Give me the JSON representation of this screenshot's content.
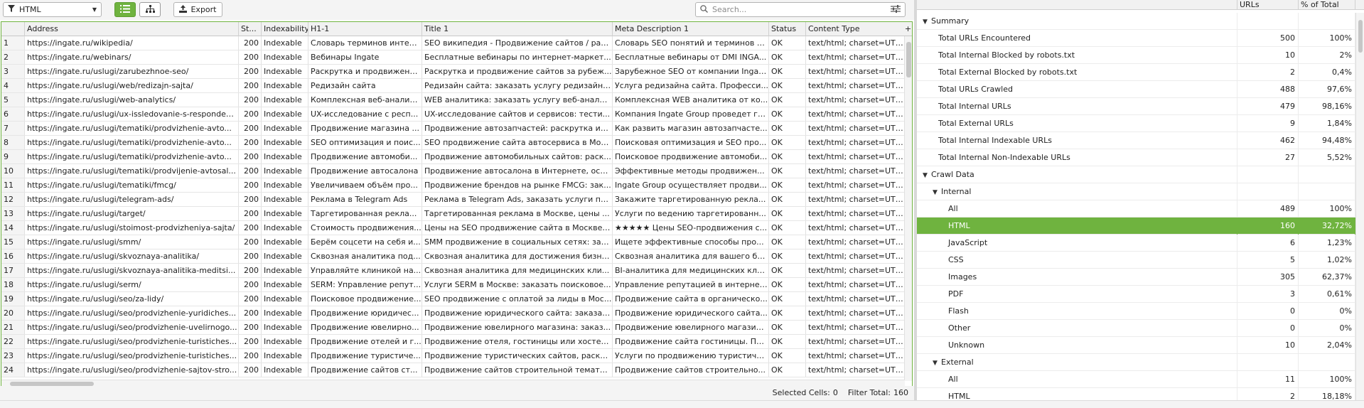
{
  "toolbar": {
    "filter_label": "HTML",
    "export_label": "Export",
    "search_placeholder": "Search..."
  },
  "table": {
    "columns": [
      "",
      "Address",
      "St...",
      "Indexability",
      "H1-1",
      "Title 1",
      "Meta Description 1",
      "Status",
      "Content Type"
    ],
    "rows": [
      {
        "num": "1",
        "address": "https://ingate.ru/wikipedia/",
        "code": "200",
        "indexability": "Indexable",
        "h1": "Словарь терминов интер...",
        "title": "SEO википедия - Продвижение сайтов / рас...",
        "meta": "Словарь SEO понятий и терминов в...",
        "status": "OK",
        "content_type": "text/html; charset=UTF-8"
      },
      {
        "num": "2",
        "address": "https://ingate.ru/webinars/",
        "code": "200",
        "indexability": "Indexable",
        "h1": "Вебинары Ingate",
        "title": "Бесплатные вебинары по интернет-маркет...",
        "meta": "Бесплатные вебинары от DMI INGA...",
        "status": "OK",
        "content_type": "text/html; charset=UTF-8"
      },
      {
        "num": "3",
        "address": "https://ingate.ru/uslugi/zarubezhnoe-seo/",
        "code": "200",
        "indexability": "Indexable",
        "h1": "Раскрутка и продвижени...",
        "title": "Раскрутка и продвижение сайтов за рубеж...",
        "meta": "Зарубежное SEO от компании Ingat...",
        "status": "OK",
        "content_type": "text/html; charset=UTF-8"
      },
      {
        "num": "4",
        "address": "https://ingate.ru/uslugi/web/redizajn-sajta/",
        "code": "200",
        "indexability": "Indexable",
        "h1": "Редизайн сайта",
        "title": "Редизайн сайта: заказать услугу редизайна...",
        "meta": "Услуга редизайна сайта. Професси...",
        "status": "OK",
        "content_type": "text/html; charset=UTF-8"
      },
      {
        "num": "5",
        "address": "https://ingate.ru/uslugi/web-analytics/",
        "code": "200",
        "indexability": "Indexable",
        "h1": "Комплексная веб-аналит...",
        "title": "WEB аналитика: заказать услугу веб-аналит...",
        "meta": "Комплексная WEB аналитика от ко...",
        "status": "OK",
        "content_type": "text/html; charset=UTF-8"
      },
      {
        "num": "6",
        "address": "https://ingate.ru/uslugi/ux-issledovanie-s-responden...",
        "code": "200",
        "indexability": "Indexable",
        "h1": "UX-исследование с респ...",
        "title": "UX-исследование сайтов и сервисов: тести...",
        "meta": "Компания Ingate Group проведет гл...",
        "status": "OK",
        "content_type": "text/html; charset=UTF-8"
      },
      {
        "num": "7",
        "address": "https://ingate.ru/uslugi/tematiki/prodvizhenie-avto...",
        "code": "200",
        "indexability": "Indexable",
        "h1": "Продвижение магазина ...",
        "title": "Продвижение автозапчастей: раскрутка ин...",
        "meta": "Как развить магазин автозапчасте...",
        "status": "OK",
        "content_type": "text/html; charset=UTF-8"
      },
      {
        "num": "8",
        "address": "https://ingate.ru/uslugi/tematiki/prodvizhenie-avto...",
        "code": "200",
        "indexability": "Indexable",
        "h1": "SEO оптимизация и поис...",
        "title": "SEO продвижение сайта автосервиса в Мос...",
        "meta": "Поисковая оптимизация и SEO про...",
        "status": "OK",
        "content_type": "text/html; charset=UTF-8"
      },
      {
        "num": "9",
        "address": "https://ingate.ru/uslugi/tematiki/prodvizhenie-avto...",
        "code": "200",
        "indexability": "Indexable",
        "h1": "Продвижение автомоби...",
        "title": "Продвижение автомобильных сайтов: раск...",
        "meta": "Поисковое продвижение автомоби...",
        "status": "OK",
        "content_type": "text/html; charset=UTF-8"
      },
      {
        "num": "10",
        "address": "https://ingate.ru/uslugi/tematiki/prodvijenie-avtosal...",
        "code": "200",
        "indexability": "Indexable",
        "h1": "Продвижение автосалона",
        "title": "Продвижение автосалона в Интернете, осо...",
        "meta": "Эффективные методы продвижен...",
        "status": "OK",
        "content_type": "text/html; charset=UTF-8"
      },
      {
        "num": "11",
        "address": "https://ingate.ru/uslugi/tematiki/fmcg/",
        "code": "200",
        "indexability": "Indexable",
        "h1": "Увеличиваем объём про...",
        "title": "Продвижение брендов на рынке FMCG: зак...",
        "meta": "Ingate Group осуществляет продви...",
        "status": "OK",
        "content_type": "text/html; charset=UTF-8"
      },
      {
        "num": "12",
        "address": "https://ingate.ru/uslugi/telegram-ads/",
        "code": "200",
        "indexability": "Indexable",
        "h1": "Реклама в Telegram Ads",
        "title": "Реклама в Telegram Ads, заказать услуги пр...",
        "meta": "Закажите таргетированную рекла...",
        "status": "OK",
        "content_type": "text/html; charset=UTF-8"
      },
      {
        "num": "13",
        "address": "https://ingate.ru/uslugi/target/",
        "code": "200",
        "indexability": "Indexable",
        "h1": "Таргетированная рекла...",
        "title": "Таргетированная реклама в Москве, цены ...",
        "meta": "Услуги по ведению таргетированн...",
        "status": "OK",
        "content_type": "text/html; charset=UTF-8"
      },
      {
        "num": "14",
        "address": "https://ingate.ru/uslugi/stoimost-prodvizheniya-sajta/",
        "code": "200",
        "indexability": "Indexable",
        "h1": "Стоимость продвижения...",
        "title": "Цены на SEO продвижение сайта в Москве ...",
        "meta": "★★★★★ Цены SEO-продвижения с...",
        "status": "OK",
        "content_type": "text/html; charset=UTF-8"
      },
      {
        "num": "15",
        "address": "https://ingate.ru/uslugi/smm/",
        "code": "200",
        "indexability": "Indexable",
        "h1": "Берём соцсети на себя и...",
        "title": "SMM продвижение в социальных сетях: зак...",
        "meta": "Ищете эффективные способы про...",
        "status": "OK",
        "content_type": "text/html; charset=UTF-8"
      },
      {
        "num": "16",
        "address": "https://ingate.ru/uslugi/skvoznaya-analitika/",
        "code": "200",
        "indexability": "Indexable",
        "h1": "Сквозная аналитика под...",
        "title": "Сквозная аналитика для достижения бизне...",
        "meta": "Сквозная аналитика для вашего би...",
        "status": "OK",
        "content_type": "text/html; charset=UTF-8"
      },
      {
        "num": "17",
        "address": "https://ingate.ru/uslugi/skvoznaya-analitika-meditsi...",
        "code": "200",
        "indexability": "Indexable",
        "h1": "Управляйте клиникой на...",
        "title": "Сквозная аналитика для медицинских кли...",
        "meta": "BI-аналитика для медицинских кли...",
        "status": "OK",
        "content_type": "text/html; charset=UTF-8"
      },
      {
        "num": "18",
        "address": "https://ingate.ru/uslugi/serm/",
        "code": "200",
        "indexability": "Indexable",
        "h1": "SERM: Управление репут...",
        "title": "Услуги SERM в Москве: заказать поисковое...",
        "meta": "Управление репутацией в интернет...",
        "status": "OK",
        "content_type": "text/html; charset=UTF-8"
      },
      {
        "num": "19",
        "address": "https://ingate.ru/uslugi/seo/za-lidy/",
        "code": "200",
        "indexability": "Indexable",
        "h1": "Поисковое продвижение...",
        "title": "SEO продвижение с оплатой за лиды в Мос...",
        "meta": "Продвижение сайта в органическо...",
        "status": "OK",
        "content_type": "text/html; charset=UTF-8"
      },
      {
        "num": "20",
        "address": "https://ingate.ru/uslugi/seo/prodvizhenie-yuridiches...",
        "code": "200",
        "indexability": "Indexable",
        "h1": "Продвижение юридичес...",
        "title": "Продвижение юридического сайта: заказат...",
        "meta": "Продвижение юридического сайта...",
        "status": "OK",
        "content_type": "text/html; charset=UTF-8"
      },
      {
        "num": "21",
        "address": "https://ingate.ru/uslugi/seo/prodvizhenie-uvelirnogo...",
        "code": "200",
        "indexability": "Indexable",
        "h1": "Продвижение ювелирно...",
        "title": "Продвижение ювелирного магазина: заказ...",
        "meta": "Продвижение ювелирного магазин...",
        "status": "OK",
        "content_type": "text/html; charset=UTF-8"
      },
      {
        "num": "22",
        "address": "https://ingate.ru/uslugi/seo/prodvizhenie-turistiches...",
        "code": "200",
        "indexability": "Indexable",
        "h1": "Продвижение отелей и г...",
        "title": "Продвижение отеля, гостиницы или хостел...",
        "meta": "Продвижение сайта гостиницы. Пр...",
        "status": "OK",
        "content_type": "text/html; charset=UTF-8"
      },
      {
        "num": "23",
        "address": "https://ingate.ru/uslugi/seo/prodvizhenie-turistiches...",
        "code": "200",
        "indexability": "Indexable",
        "h1": "Продвижение туристиче...",
        "title": "Продвижение туристических сайтов, раскр...",
        "meta": "Услуги по продвижению туристиче...",
        "status": "OK",
        "content_type": "text/html; charset=UTF-8"
      },
      {
        "num": "24",
        "address": "https://ingate.ru/uslugi/seo/prodvizhenie-sajtov-stro...",
        "code": "200",
        "indexability": "Indexable",
        "h1": "Продвижение сайтов ст...",
        "title": "Продвижение сайтов строительной темати...",
        "meta": "Продвижение сайтов строительно...",
        "status": "OK",
        "content_type": "text/html; charset=UTF-8"
      }
    ]
  },
  "status_bar": {
    "selected_label": "Selected Cells:",
    "selected_value": "0",
    "filter_label": "Filter Total:",
    "filter_value": "160"
  },
  "overview": {
    "columns": [
      "",
      "URLs",
      "% of Total"
    ],
    "rows": [
      {
        "label": "Summary",
        "urls": "",
        "pct": "",
        "level": 0,
        "toggle": "open"
      },
      {
        "label": "Total URLs Encountered",
        "urls": "500",
        "pct": "100%",
        "level": 1
      },
      {
        "label": "Total Internal Blocked by robots.txt",
        "urls": "10",
        "pct": "2%",
        "level": 1
      },
      {
        "label": "Total External Blocked by robots.txt",
        "urls": "2",
        "pct": "0,4%",
        "level": 1
      },
      {
        "label": "Total URLs Crawled",
        "urls": "488",
        "pct": "97,6%",
        "level": 1
      },
      {
        "label": "Total Internal URLs",
        "urls": "479",
        "pct": "98,16%",
        "level": 1
      },
      {
        "label": "Total External URLs",
        "urls": "9",
        "pct": "1,84%",
        "level": 1
      },
      {
        "label": "Total Internal Indexable URLs",
        "urls": "462",
        "pct": "94,48%",
        "level": 1
      },
      {
        "label": "Total Internal Non-Indexable URLs",
        "urls": "27",
        "pct": "5,52%",
        "level": 1
      },
      {
        "label": "Crawl Data",
        "urls": "",
        "pct": "",
        "level": 0,
        "toggle": "open"
      },
      {
        "label": "Internal",
        "urls": "",
        "pct": "",
        "level": 1,
        "toggle": "open"
      },
      {
        "label": "All",
        "urls": "489",
        "pct": "100%",
        "level": 2
      },
      {
        "label": "HTML",
        "urls": "160",
        "pct": "32,72%",
        "level": 2,
        "selected": true
      },
      {
        "label": "JavaScript",
        "urls": "6",
        "pct": "1,23%",
        "level": 2
      },
      {
        "label": "CSS",
        "urls": "5",
        "pct": "1,02%",
        "level": 2
      },
      {
        "label": "Images",
        "urls": "305",
        "pct": "62,37%",
        "level": 2
      },
      {
        "label": "PDF",
        "urls": "3",
        "pct": "0,61%",
        "level": 2
      },
      {
        "label": "Flash",
        "urls": "0",
        "pct": "0%",
        "level": 2
      },
      {
        "label": "Other",
        "urls": "0",
        "pct": "0%",
        "level": 2
      },
      {
        "label": "Unknown",
        "urls": "10",
        "pct": "2,04%",
        "level": 2
      },
      {
        "label": "External",
        "urls": "",
        "pct": "",
        "level": 1,
        "toggle": "open"
      },
      {
        "label": "All",
        "urls": "11",
        "pct": "100%",
        "level": 2
      },
      {
        "label": "HTML",
        "urls": "2",
        "pct": "18,18%",
        "level": 2
      }
    ]
  },
  "colors": {
    "accent": "#6fb33f",
    "header_bg": "#f1f1f1"
  },
  "icons": [
    "filter-icon",
    "chevron-down-icon",
    "list-view-icon",
    "tree-view-icon",
    "export-icon",
    "search-icon",
    "sliders-icon",
    "add-column-icon",
    "triangle-down-icon"
  ]
}
